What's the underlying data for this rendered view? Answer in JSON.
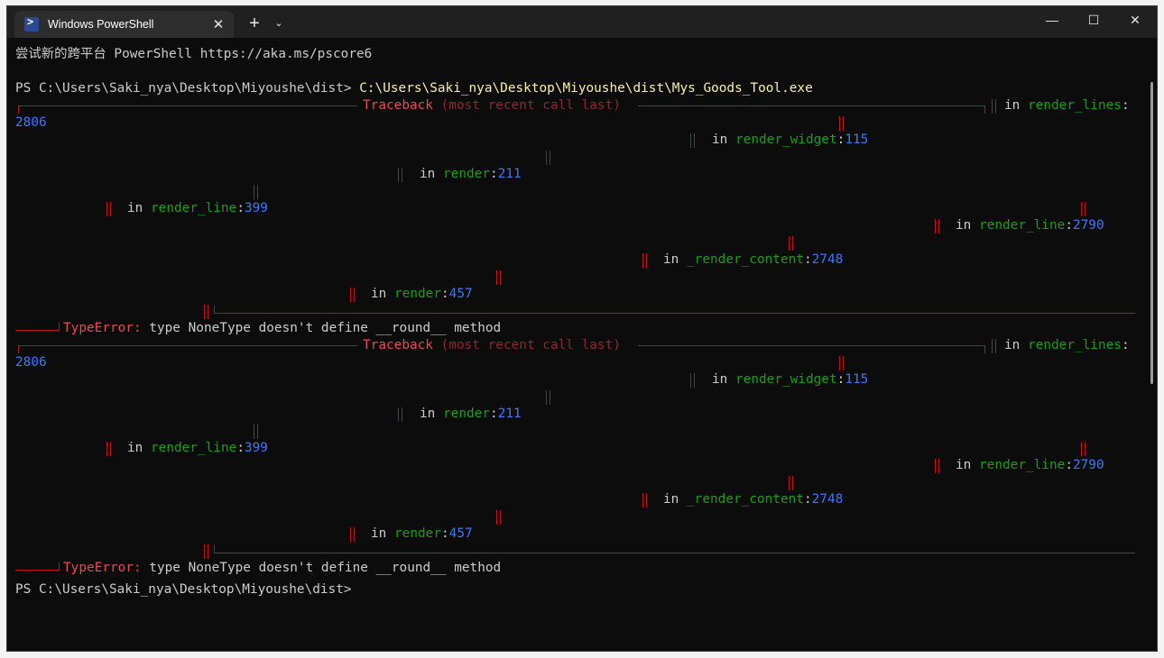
{
  "window": {
    "tab_title": "Windows PowerShell",
    "tab_close": "✕",
    "new_tab": "+",
    "dropdown": "⌄",
    "minimize": "—",
    "maximize": "☐",
    "close": "✕"
  },
  "icons": [
    "powershell-icon"
  ],
  "terminal": {
    "banner": "尝试新的跨平台 PowerShell https://aka.ms/pscore6",
    "prompt": "PS C:\\Users\\Saki_nya\\Desktop\\Miyoushe\\dist>",
    "command": " C:\\Users\\Saki_nya\\Desktop\\Miyoushe\\dist\\Mys_Goods_Tool.exe",
    "traceback_title": "Traceback",
    "traceback_sub": " (most recent call last)",
    "in": "in ",
    "colon": ":",
    "frames": [
      {
        "func": "render_lines",
        "line": "2806"
      },
      {
        "func": "render_widget",
        "line": "115"
      },
      {
        "func": "render",
        "line": "211"
      },
      {
        "func": "render_line",
        "line": "399"
      },
      {
        "func": "render_line",
        "line": "2790"
      },
      {
        "func": "_render_content",
        "line": "2748"
      },
      {
        "func": "render",
        "line": "457"
      }
    ],
    "error_type": "TypeError:",
    "error_msg": " type NoneType doesn't define __round__ method",
    "final_prompt": "PS C:\\Users\\Saki_nya\\Desktop\\Miyoushe\\dist>"
  },
  "colors": {
    "background": "#0c0c0c",
    "text": "#cccccc",
    "command": "#f9f1a5",
    "func": "#13a10e",
    "lineno": "#3b78ff",
    "error": "#e74856",
    "rule": "#c50f1f"
  }
}
